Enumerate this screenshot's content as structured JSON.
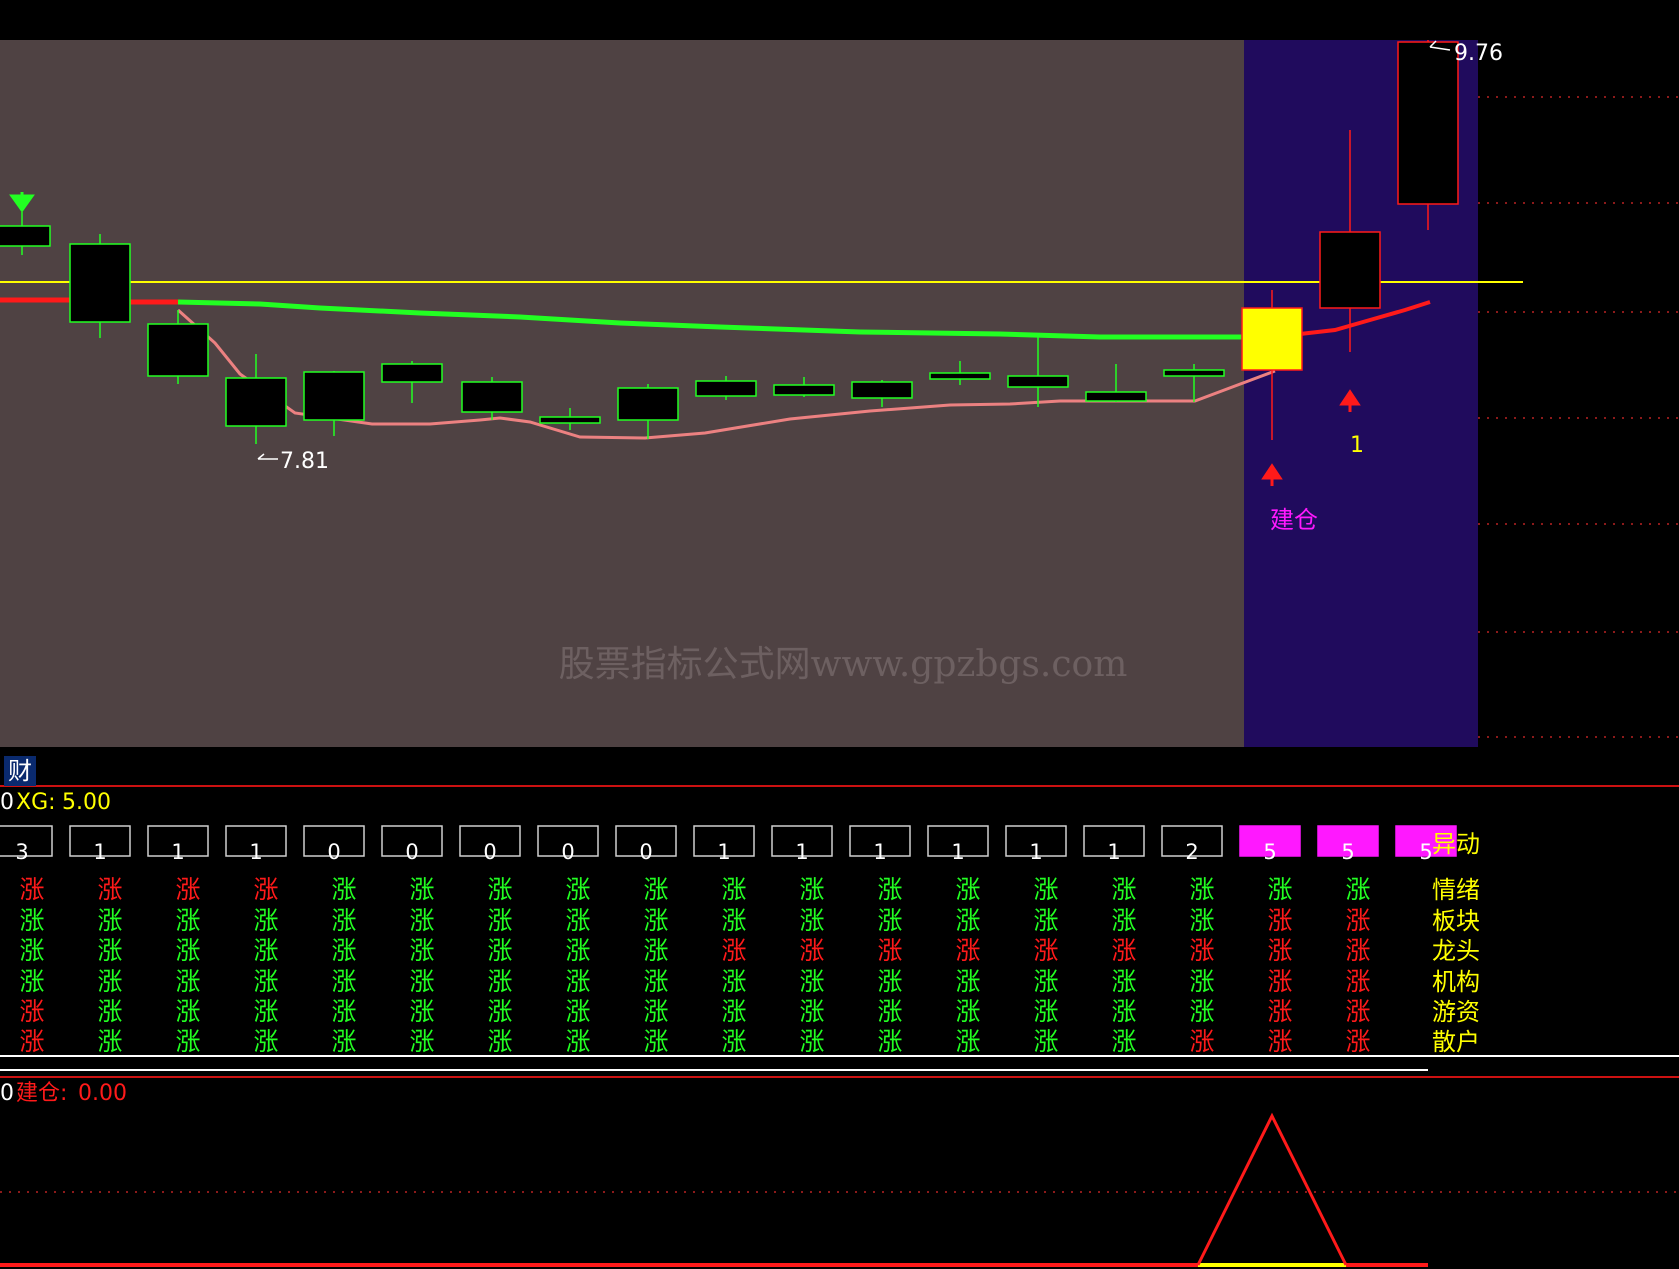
{
  "colors": {
    "main_bg": "#4f4243",
    "highlight_bg": "#200b5d",
    "bull": "#ff1a1a",
    "bear": "#22ff22",
    "yellow": "#ffff00",
    "magenta": "#ff18ff",
    "pink": "#ec8181",
    "grid": "#bb2222"
  },
  "price_chart": {
    "high_label": "9.76",
    "low_label": "7.81",
    "signal_label": "建仓",
    "signal_count": "1",
    "watermark": "股票指标公式网www.gpzbgs.com"
  },
  "panel2": {
    "tab_label": "财",
    "title_prefix": "0",
    "xg_label": "XG:",
    "xg_value": "5.00",
    "scores": [
      "3",
      "1",
      "1",
      "1",
      "0",
      "0",
      "0",
      "0",
      "0",
      "1",
      "1",
      "1",
      "1",
      "1",
      "1",
      "2",
      "5",
      "5",
      "5"
    ],
    "highlight": [
      false,
      false,
      false,
      false,
      false,
      false,
      false,
      false,
      false,
      false,
      false,
      false,
      false,
      false,
      false,
      false,
      true,
      true,
      true
    ],
    "cell_char": "涨",
    "row_labels": [
      "异动",
      "情绪",
      "板块",
      "龙头",
      "机构",
      "游资",
      "散户"
    ],
    "rows": [
      "RRRRGGGGGGGGGGGGGGG",
      "GGGGGGGGGGGGGGGGRRR",
      "GGGGGGGGGRRRRRRRRRR",
      "GGGGGGGGGGGGGGGGRRR",
      "RGGGGGGGGGGGGGGGRRR",
      "RGGGGGGGGGGGGGGRRRR"
    ]
  },
  "panel3": {
    "title_prefix": "0",
    "jc_label": "建仓:",
    "jc_value": "0.00"
  }
}
